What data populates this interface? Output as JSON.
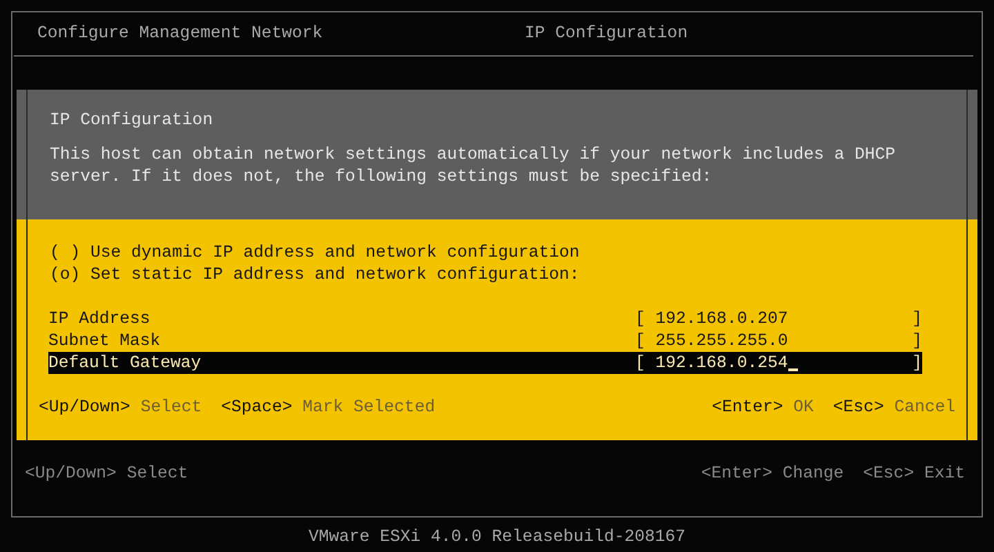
{
  "header": {
    "title": "Configure Management Network",
    "section": "IP Configuration"
  },
  "dialog": {
    "title": "IP Configuration",
    "description": "This host can obtain network settings automatically if your network includes a DHCP server. If it does not, the following settings must be specified:",
    "options": [
      {
        "marker": "( )",
        "label": "Use dynamic IP address and network configuration"
      },
      {
        "marker": "(o)",
        "label": "Set static IP address and network configuration:"
      }
    ],
    "fields": [
      {
        "label": "IP Address",
        "open": "[",
        "value": "192.168.0.207",
        "close": "]",
        "selected": false
      },
      {
        "label": "Subnet Mask",
        "open": "[",
        "value": "255.255.255.0",
        "close": "]",
        "selected": false
      },
      {
        "label": "Default Gateway",
        "open": "[",
        "value": "192.168.0.254",
        "close": "]",
        "selected": true
      }
    ],
    "hints_left": [
      {
        "key": "<Up/Down>",
        "action": "Select"
      },
      {
        "key": "<Space>",
        "action": "Mark Selected"
      }
    ],
    "hints_right": [
      {
        "key": "<Enter>",
        "action": "OK"
      },
      {
        "key": "<Esc>",
        "action": "Cancel"
      }
    ]
  },
  "hints_left": [
    {
      "key": "<Up/Down>",
      "action": "Select"
    }
  ],
  "hints_right": [
    {
      "key": "<Enter>",
      "action": "Change"
    },
    {
      "key": "<Esc>",
      "action": "Exit"
    }
  ],
  "footer": "VMware ESXi 4.0.0 Releasebuild-208167"
}
